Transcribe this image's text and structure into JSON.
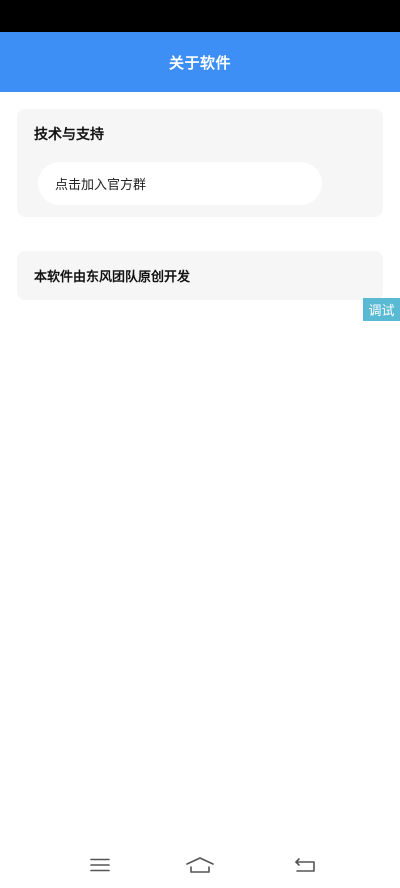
{
  "header": {
    "title": "关于软件",
    "background": "#3d8ef5"
  },
  "support_card": {
    "title": "技术与支持",
    "join_button_label": "点击加入官方群"
  },
  "credit_card": {
    "text": "本软件由东风团队原创开发"
  },
  "debug_tab": {
    "label": "调试",
    "color": "#5bbad3"
  },
  "nav_bar": {
    "icons": [
      "menu-icon",
      "home-icon",
      "back-icon"
    ]
  }
}
